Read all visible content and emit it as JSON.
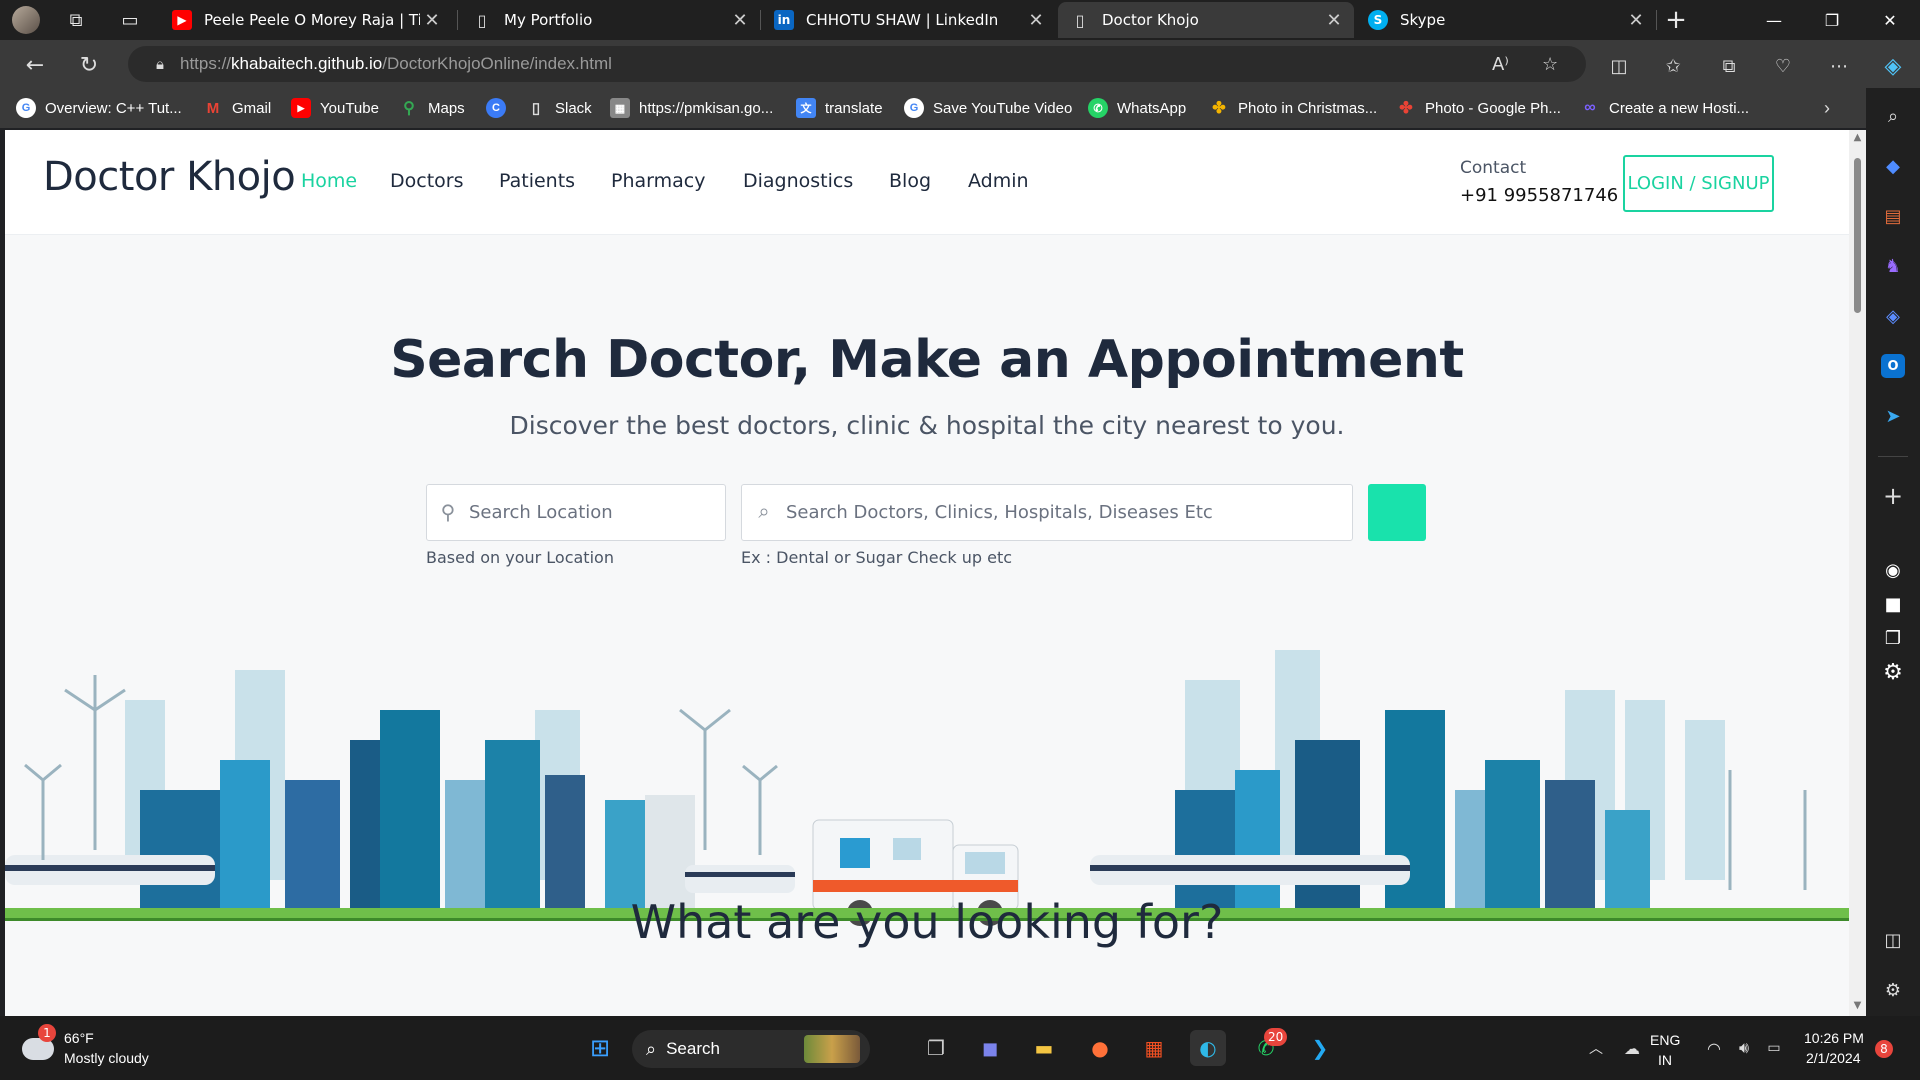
{
  "tabs": [
    {
      "title": "Peele Peele O Morey Raja | Tirang",
      "favicon": "youtube-icon",
      "color": "#ff0000"
    },
    {
      "title": "My Portfolio",
      "favicon": "document-icon",
      "color": "#cccccc"
    },
    {
      "title": "CHHOTU SHAW | LinkedIn",
      "favicon": "linkedin-icon",
      "color": "#0a66c2"
    },
    {
      "title": "Doctor Khojo",
      "favicon": "document-icon",
      "color": "#cccccc"
    },
    {
      "title": "Skype",
      "favicon": "skype-icon",
      "color": "#00aff0"
    }
  ],
  "address": {
    "url_prefix": "https://",
    "url_host": "khabaitech.github.io",
    "url_path": "/DoctorKhojoOnline/index.html"
  },
  "favorites": [
    {
      "label": "Overview: C++ Tut...",
      "icon": "google-icon",
      "color": "#ffffff"
    },
    {
      "label": "Gmail",
      "icon": "gmail-icon",
      "color": "#ea4335"
    },
    {
      "label": "YouTube",
      "icon": "youtube-icon",
      "color": "#ff0000"
    },
    {
      "label": "Maps",
      "icon": "maps-icon",
      "color": "#34a853"
    },
    {
      "label": "",
      "icon": "circle-c-icon",
      "color": "#3b7bf6"
    },
    {
      "label": "Slack",
      "icon": "document-icon",
      "color": "#cccccc"
    },
    {
      "label": "https://pmkisan.go...",
      "icon": "pmkisan-icon",
      "color": "#888888"
    },
    {
      "label": "translate",
      "icon": "translate-icon",
      "color": "#4285f4"
    },
    {
      "label": "Save YouTube Video",
      "icon": "google-icon",
      "color": "#ffffff"
    },
    {
      "label": "WhatsApp",
      "icon": "whatsapp-icon",
      "color": "#25d366"
    },
    {
      "label": "Photo in Christmas...",
      "icon": "pinwheel-icon",
      "color": "#f4b400"
    },
    {
      "label": "Photo - Google Ph...",
      "icon": "google-photos-icon",
      "color": "#ea4335"
    },
    {
      "label": "Create a new Hosti...",
      "icon": "infinity-icon",
      "color": "#7b61ff"
    }
  ],
  "site": {
    "logo": "Doctor Khojo",
    "nav": [
      "Home",
      "Doctors",
      "Patients",
      "Pharmacy",
      "Diagnostics",
      "Blog",
      "Admin"
    ],
    "active_nav": "Home",
    "contact_label": "Contact",
    "contact_phone": "+91 9955871746",
    "login_label": "LOGIN / SIGNUP",
    "accent": "#1ad3a0"
  },
  "hero": {
    "title": "Search Doctor, Make an Appointment",
    "subtitle": "Discover the best doctors, clinic & hospital the city nearest to you.",
    "location_placeholder": "Search Location",
    "location_hint": "Based on your Location",
    "search_placeholder": "Search Doctors, Clinics, Hospitals, Diseases Etc",
    "search_hint": "Ex : Dental or Sugar Check up etc"
  },
  "section": {
    "title": "What are you looking for?"
  },
  "taskbar": {
    "weather_temp": "66°F",
    "weather_desc": "Mostly cloudy",
    "weather_badge": "1",
    "search_label": "Search",
    "whatsapp_badge": "20",
    "lang_top": "ENG",
    "lang_bottom": "IN",
    "time": "10:26 PM",
    "date": "2/1/2024",
    "notification_count": "8"
  }
}
